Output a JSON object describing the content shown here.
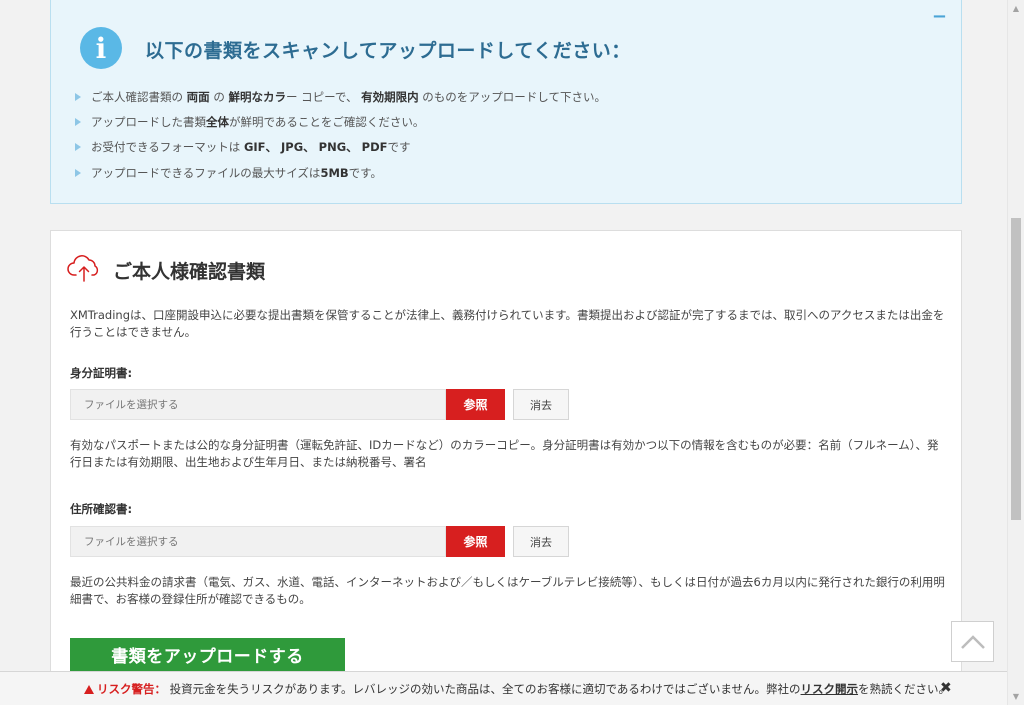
{
  "info": {
    "title": "以下の書類をスキャンしてアップロードしてください：",
    "collapse_label": "−",
    "items": [
      {
        "pre": "ご本人確認書類の",
        "b1": "両面",
        "mid1": "の",
        "b2": "鮮明なカラ",
        "mid2": "ー コピーで、",
        "b3": "有効期限内",
        "post": "のものをアップロードして下さい。"
      },
      {
        "pre": "アップロードした書類",
        "b1": "全体",
        "post": "が鮮明であることをご確認ください。"
      },
      {
        "pre": "お受付できるフォーマットは",
        "b1": "GIF、 JPG、 PNG、 PDF",
        "post": "です"
      },
      {
        "pre": "アップロードできるファイルの最大サイズは",
        "b1": "5MB",
        "post": "です。"
      }
    ]
  },
  "doc": {
    "title": "ご本人様確認書類",
    "description": "XMTradingは、口座開設申込に必要な提出書類を保管することが法律上、義務付けられています。書類提出および認証が完了するまでは、取引へのアクセスまたは出金を行うことはできません。",
    "identity": {
      "label": "身分証明書:",
      "placeholder": "ファイルを選択する",
      "browse": "参照",
      "clear": "消去",
      "description": "有効なパスポートまたは公的な身分証明書（運転免許証、IDカードなど）のカラーコピー。身分証明書は有効かつ以下の情報を含むものが必要：名前（フルネーム）、発行日または有効期限、出生地および生年月日、または納税番号、署名"
    },
    "address": {
      "label": "住所確認書:",
      "placeholder": "ファイルを選択する",
      "browse": "参照",
      "clear": "消去",
      "description": "最近の公共料金の請求書（電気、ガス、水道、電話、インターネットおよび／もしくはケーブルテレビ接続等）、もしくは日付が過去6カ月以内に発行された銀行の利用明細書で、お客様の登録住所が確認できるもの。"
    },
    "upload_button": "書類をアップロードする"
  },
  "risk": {
    "label": "リスク警告：",
    "text": "投資元金を失うリスクがあります。レバレッジの効いた商品は、全てのお客様に適切であるわけではございません。弊社の",
    "link": "リスク開示",
    "suffix": "を熟読ください。",
    "close": "✖"
  },
  "colors": {
    "accent_red": "#d71f1f",
    "accent_green": "#2f9a3b",
    "info_blue": "#5ab8e6"
  }
}
